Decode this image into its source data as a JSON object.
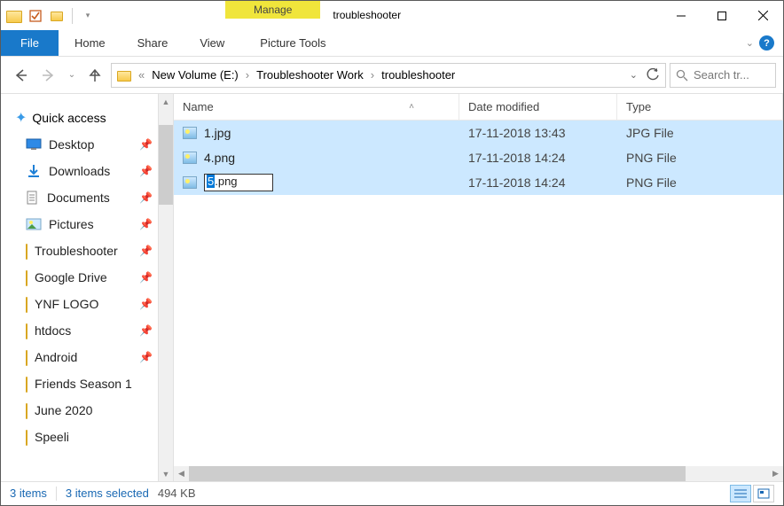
{
  "titlebar": {
    "manage_label": "Manage",
    "title": "troubleshooter"
  },
  "ribbon": {
    "file_label": "File",
    "tabs": [
      "Home",
      "Share",
      "View"
    ],
    "context_tab": "Picture Tools"
  },
  "breadcrumbs": [
    "New Volume (E:)",
    "Troubleshooter Work",
    "troubleshooter"
  ],
  "search": {
    "placeholder": "Search tr..."
  },
  "sidebar": {
    "quick_access": "Quick access",
    "items": [
      {
        "label": "Desktop",
        "icon": "desktop",
        "pinned": true
      },
      {
        "label": "Downloads",
        "icon": "downloads",
        "pinned": true
      },
      {
        "label": "Documents",
        "icon": "documents",
        "pinned": true
      },
      {
        "label": "Pictures",
        "icon": "pictures",
        "pinned": true
      },
      {
        "label": "Troubleshooter",
        "icon": "folder",
        "pinned": true
      },
      {
        "label": "Google Drive",
        "icon": "folder",
        "pinned": true
      },
      {
        "label": "YNF LOGO",
        "icon": "folder",
        "pinned": true
      },
      {
        "label": "htdocs",
        "icon": "folder",
        "pinned": true
      },
      {
        "label": "Android",
        "icon": "folder",
        "pinned": true
      },
      {
        "label": "Friends Season 1",
        "icon": "folder",
        "pinned": false
      },
      {
        "label": "June 2020",
        "icon": "folder",
        "pinned": false
      },
      {
        "label": "Speeli",
        "icon": "folder",
        "pinned": false
      }
    ]
  },
  "columns": {
    "name": "Name",
    "date": "Date modified",
    "type": "Type"
  },
  "files": [
    {
      "name": "1.jpg",
      "date": "17-11-2018 13:43",
      "type": "JPG File"
    },
    {
      "name": "4.png",
      "date": "17-11-2018 14:24",
      "type": "PNG File"
    },
    {
      "name": "5.png",
      "date": "17-11-2018 14:24",
      "type": "PNG File",
      "renaming": true,
      "rename_sel": "5",
      "rename_rest": ".png"
    }
  ],
  "status": {
    "item_count": "3 items",
    "selection": "3 items selected",
    "size": "494 KB"
  }
}
